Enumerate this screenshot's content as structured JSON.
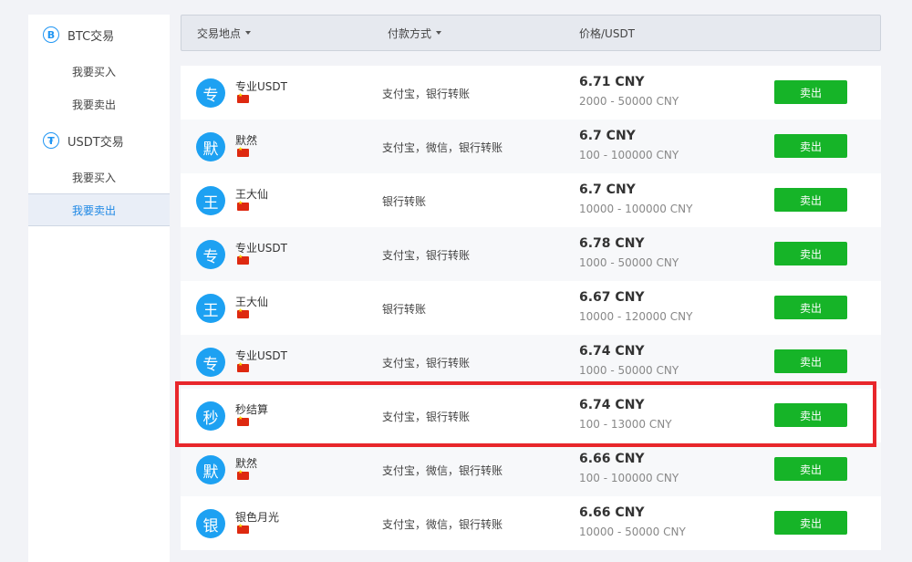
{
  "sidebar": {
    "groups": [
      {
        "icon": "bitcoin-icon",
        "icon_glyph": "B",
        "title": "BTC交易",
        "items": [
          {
            "label": "我要买入",
            "active": false
          },
          {
            "label": "我要卖出",
            "active": false
          }
        ]
      },
      {
        "icon": "tether-icon",
        "icon_glyph": "₮",
        "title": "USDT交易",
        "items": [
          {
            "label": "我要买入",
            "active": false
          },
          {
            "label": "我要卖出",
            "active": true
          }
        ]
      }
    ]
  },
  "table": {
    "headers": {
      "location": "交易地点",
      "payment": "付款方式",
      "price": "价格/USDT"
    },
    "sell_label": "卖出",
    "rows": [
      {
        "avatar": "专",
        "name": "专业USDT",
        "payment": "支付宝，银行转账",
        "price": "6.71 CNY",
        "limit": "2000 - 50000 CNY"
      },
      {
        "avatar": "默",
        "name": "默然",
        "payment": "支付宝，微信，银行转账",
        "price": "6.7 CNY",
        "limit": "100 - 100000 CNY"
      },
      {
        "avatar": "王",
        "name": "王大仙",
        "payment": "银行转账",
        "price": "6.7 CNY",
        "limit": "10000 - 100000 CNY"
      },
      {
        "avatar": "专",
        "name": "专业USDT",
        "payment": "支付宝，银行转账",
        "price": "6.78 CNY",
        "limit": "1000 - 50000 CNY"
      },
      {
        "avatar": "王",
        "name": "王大仙",
        "payment": "银行转账",
        "price": "6.67 CNY",
        "limit": "10000 - 120000 CNY"
      },
      {
        "avatar": "专",
        "name": "专业USDT",
        "payment": "支付宝，银行转账",
        "price": "6.74 CNY",
        "limit": "1000 - 50000 CNY"
      },
      {
        "avatar": "秒",
        "name": "秒结算",
        "payment": "支付宝，银行转账",
        "price": "6.74 CNY",
        "limit": "100 - 13000 CNY",
        "highlighted": true
      },
      {
        "avatar": "默",
        "name": "默然",
        "payment": "支付宝，微信，银行转账",
        "price": "6.66 CNY",
        "limit": "100 - 100000 CNY"
      },
      {
        "avatar": "银",
        "name": "银色月光",
        "payment": "支付宝，微信，银行转账",
        "price": "6.66 CNY",
        "limit": "10000 - 50000 CNY"
      }
    ]
  },
  "colors": {
    "accent_blue": "#1da1f2",
    "sell_green": "#16b428",
    "highlight_red": "#e8262b"
  }
}
